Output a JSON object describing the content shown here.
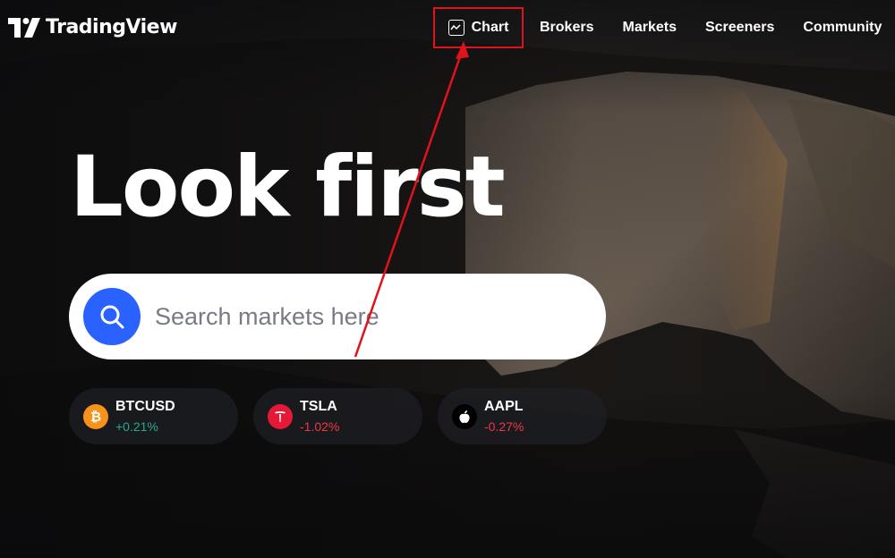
{
  "brand": {
    "name": "TradingView"
  },
  "nav": {
    "items": [
      {
        "label": "Chart",
        "icon": "chart-line-icon",
        "highlighted": true
      },
      {
        "label": "Brokers"
      },
      {
        "label": "Markets"
      },
      {
        "label": "Screeners"
      },
      {
        "label": "Community"
      }
    ]
  },
  "hero": {
    "title": "Look first",
    "search": {
      "placeholder": "Search markets here",
      "icon": "search-icon"
    }
  },
  "tickers": [
    {
      "symbol": "BTCUSD",
      "change": "+0.21%",
      "direction": "up",
      "icon": "bitcoin-icon",
      "icon_color": "#f7931a"
    },
    {
      "symbol": "TSLA",
      "change": "-1.02%",
      "direction": "down",
      "icon": "tesla-icon",
      "icon_color": "#e31937"
    },
    {
      "symbol": "AAPL",
      "change": "-0.27%",
      "direction": "down",
      "icon": "apple-icon",
      "icon_color": "#000000"
    }
  ],
  "colors": {
    "accent": "#2962ff",
    "positive": "#22ab94",
    "negative": "#f23645",
    "highlight": "#e0121b"
  }
}
